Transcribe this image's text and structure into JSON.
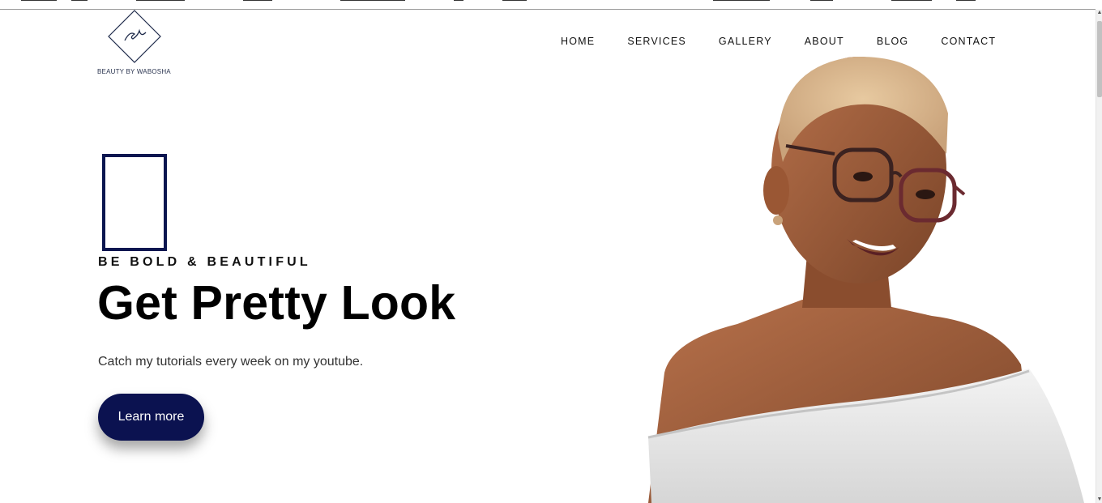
{
  "header": {
    "logo": {
      "monogram": "BW",
      "brand_text": "BEAUTY BY WABOSHA"
    },
    "nav": [
      "HOME",
      "SERVICES",
      "GALLERY",
      "ABOUT",
      "BLOG",
      "CONTACT"
    ]
  },
  "hero": {
    "kicker": "BE BOLD & BEAUTIFUL",
    "headline": "Get Pretty Look",
    "subtext": "Catch my tutorials every week on my youtube.",
    "cta_label": "Learn more",
    "image": "smiling-woman-with-glasses-portrait"
  },
  "colors": {
    "accent_navy": "#0b1250",
    "frame_navy": "#0b1650",
    "text_dark": "#111111",
    "background": "#ffffff"
  }
}
